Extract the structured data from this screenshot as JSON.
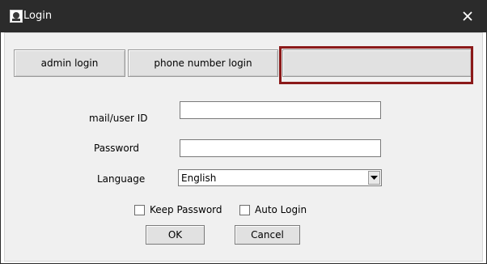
{
  "window": {
    "title": "Login",
    "close_glyph": "✕"
  },
  "tabs": [
    {
      "label": "admin login"
    },
    {
      "label": "phone number login"
    },
    {
      "label": ""
    }
  ],
  "form": {
    "mail_label": "mail/user ID",
    "mail_value": "",
    "password_label": "Password",
    "password_value": "",
    "language_label": "Language",
    "language_selected": "English"
  },
  "options": {
    "keep_password": {
      "label": "Keep Password",
      "checked": false
    },
    "auto_login": {
      "label": "Auto Login",
      "checked": false
    }
  },
  "buttons": {
    "ok": "OK",
    "cancel": "Cancel"
  },
  "colors": {
    "titlebar": "#2b2b2b",
    "highlight": "#8b1a1a",
    "dialog_bg": "#f0f0f0"
  }
}
